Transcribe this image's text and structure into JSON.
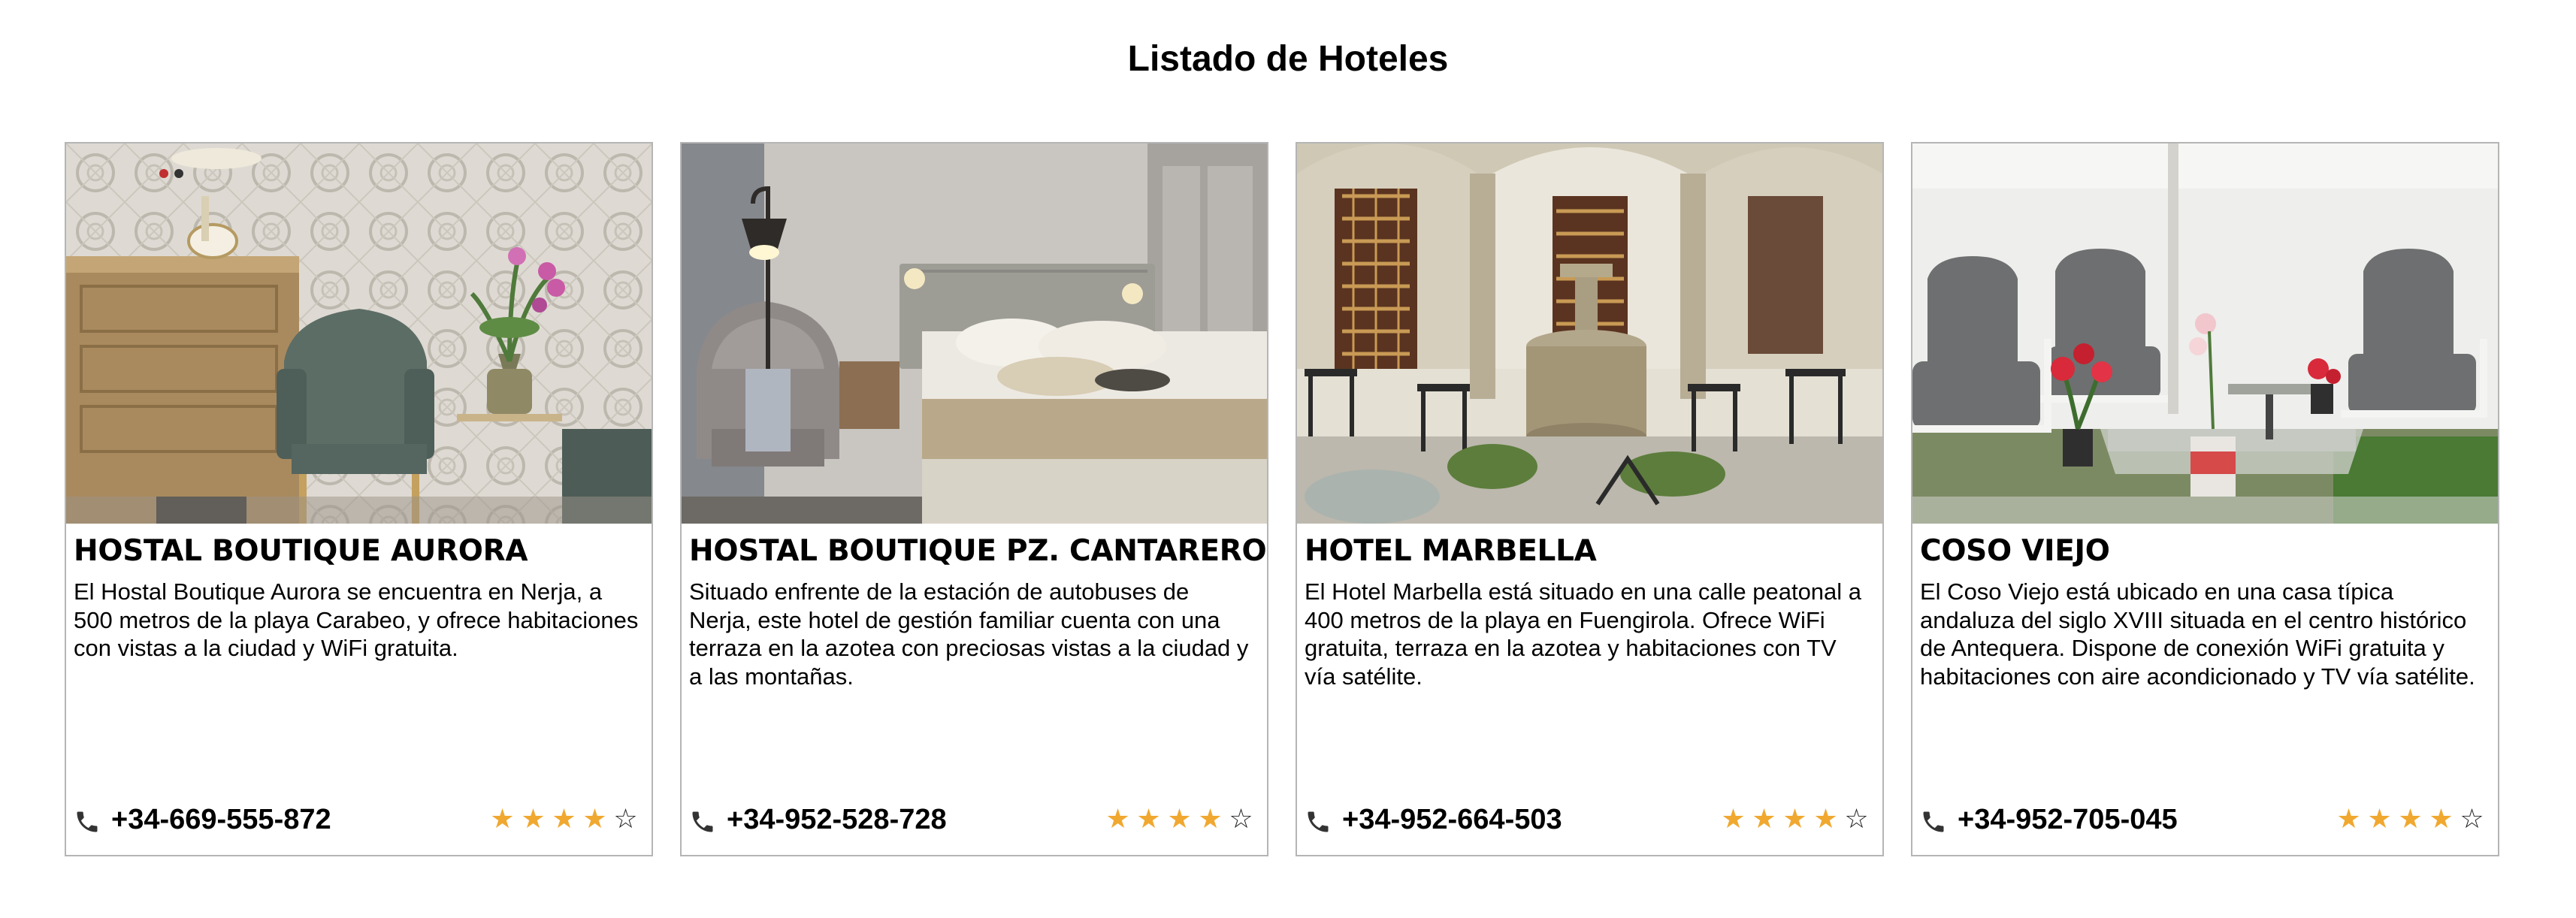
{
  "page": {
    "title": "Listado de Hoteles"
  },
  "colors": {
    "star_filled": "#f0a830",
    "star_empty": "#222222",
    "card_border": "#b5b5b5"
  },
  "hotels": [
    {
      "name": "HOSTAL BOUTIQUE AURORA",
      "description": "El Hostal Boutique Aurora se encuentra en Nerja, a 500 metros de la playa Carabeo, y ofrece habitaciones con vistas a la ciudad y WiFi gratuita.",
      "phone": "+34-669-555-872",
      "rating": 4,
      "rating_max": 5,
      "image_icon": "hotel-lobby-photo"
    },
    {
      "name": "HOSTAL BOUTIQUE PZ. CANTARERO",
      "description": "Situado enfrente de la estación de autobuses de Nerja, este hotel de gestión familiar cuenta con una terraza en la azotea con preciosas vistas a la ciudad y a las montañas.",
      "phone": "+34-952-528-728",
      "rating": 4,
      "rating_max": 5,
      "image_icon": "hotel-bedroom-photo"
    },
    {
      "name": "HOTEL MARBELLA",
      "description": "El Hotel Marbella está situado en una calle peatonal a 400 metros de la playa en Fuengirola. Ofrece WiFi gratuita, terraza en la azotea y habitaciones con TV vía satélite.",
      "phone": "+34-952-664-503",
      "rating": 4,
      "rating_max": 5,
      "image_icon": "hotel-courtyard-photo"
    },
    {
      "name": "COSO VIEJO",
      "description": "El Coso Viejo está ubicado en una casa típica andaluza del siglo XVIII situada en el centro histórico de Antequera. Dispone de conexión WiFi gratuita y habitaciones con aire acondicionado y TV vía satélite.",
      "phone": "+34-952-705-045",
      "rating": 4,
      "rating_max": 5,
      "image_icon": "hotel-terrace-photo"
    }
  ],
  "icons": {
    "phone": "phone-icon",
    "star_full": "star-filled-icon",
    "star_empty": "star-empty-icon"
  }
}
